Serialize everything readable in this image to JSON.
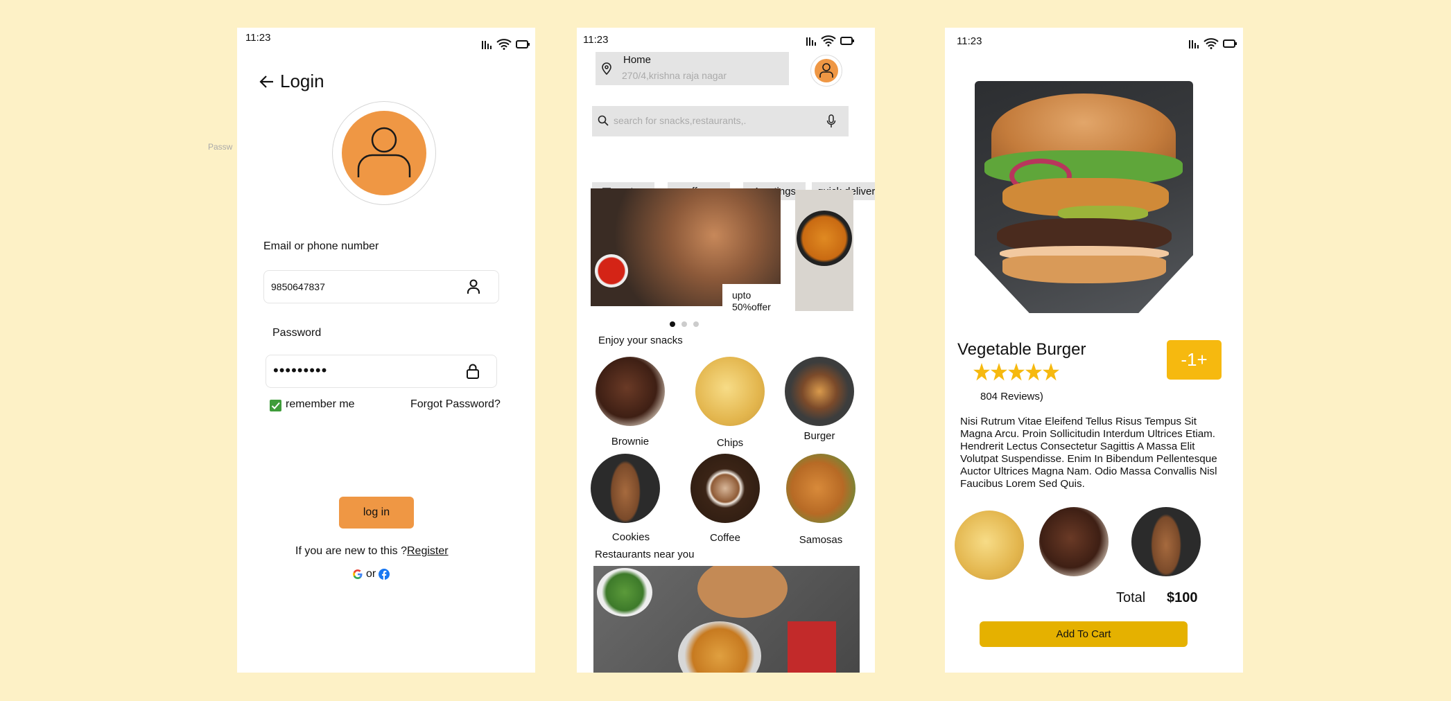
{
  "stray_label": "Passw",
  "login": {
    "time": "11:23",
    "title": "Login",
    "email_label": "Email or phone number",
    "email_value": "9850647837",
    "password_label": "Password",
    "password_value": "•••••••••",
    "remember_label": "remember me",
    "forgot_label": "Forgot Password?",
    "login_button": "log in",
    "register_prompt": "If you are new to this ?",
    "register_link": "Register",
    "or_label": "or",
    "accent": "#ef9744"
  },
  "home": {
    "time": "11:23",
    "location_title": "Home",
    "location_address": "270/4,krishna raja nagar",
    "search_placeholder": "search for snacks,restaurants,.",
    "chips": [
      "sort",
      "offers",
      "4+ratings",
      "quick deliver"
    ],
    "offer_text": "upto\n50%offer",
    "snacks_heading": "Enjoy your snacks",
    "snacks": [
      "Brownie",
      "Chips",
      "Burger",
      "Cookies",
      "Coffee",
      "Samosas"
    ],
    "restaurants_heading": "Restaurants near you"
  },
  "detail": {
    "time": "11:23",
    "product_name": "Vegetable Burger",
    "quantity_badge": "-1+",
    "rating": 5,
    "reviews": "804 Reviews)",
    "description": "Nisi Rutrum Vitae Eleifend Tellus Risus Tempus Sit Magna Arcu. Proin Sollicitudin Interdum Ultrices Etiam. Hendrerit Lectus Consectetur Sagittis A Massa Elit Volutpat Suspendisse. Enim In Bibendum Pellentesque Auctor Ultrices Magna Nam. Odio Massa Convallis Nisl Faucibus Lorem Sed Quis.",
    "total_label": "Total",
    "total_value": "$100",
    "add_to_cart": "Add To Cart",
    "badge_color": "#f6b90f",
    "cart_color": "#e5b100"
  }
}
